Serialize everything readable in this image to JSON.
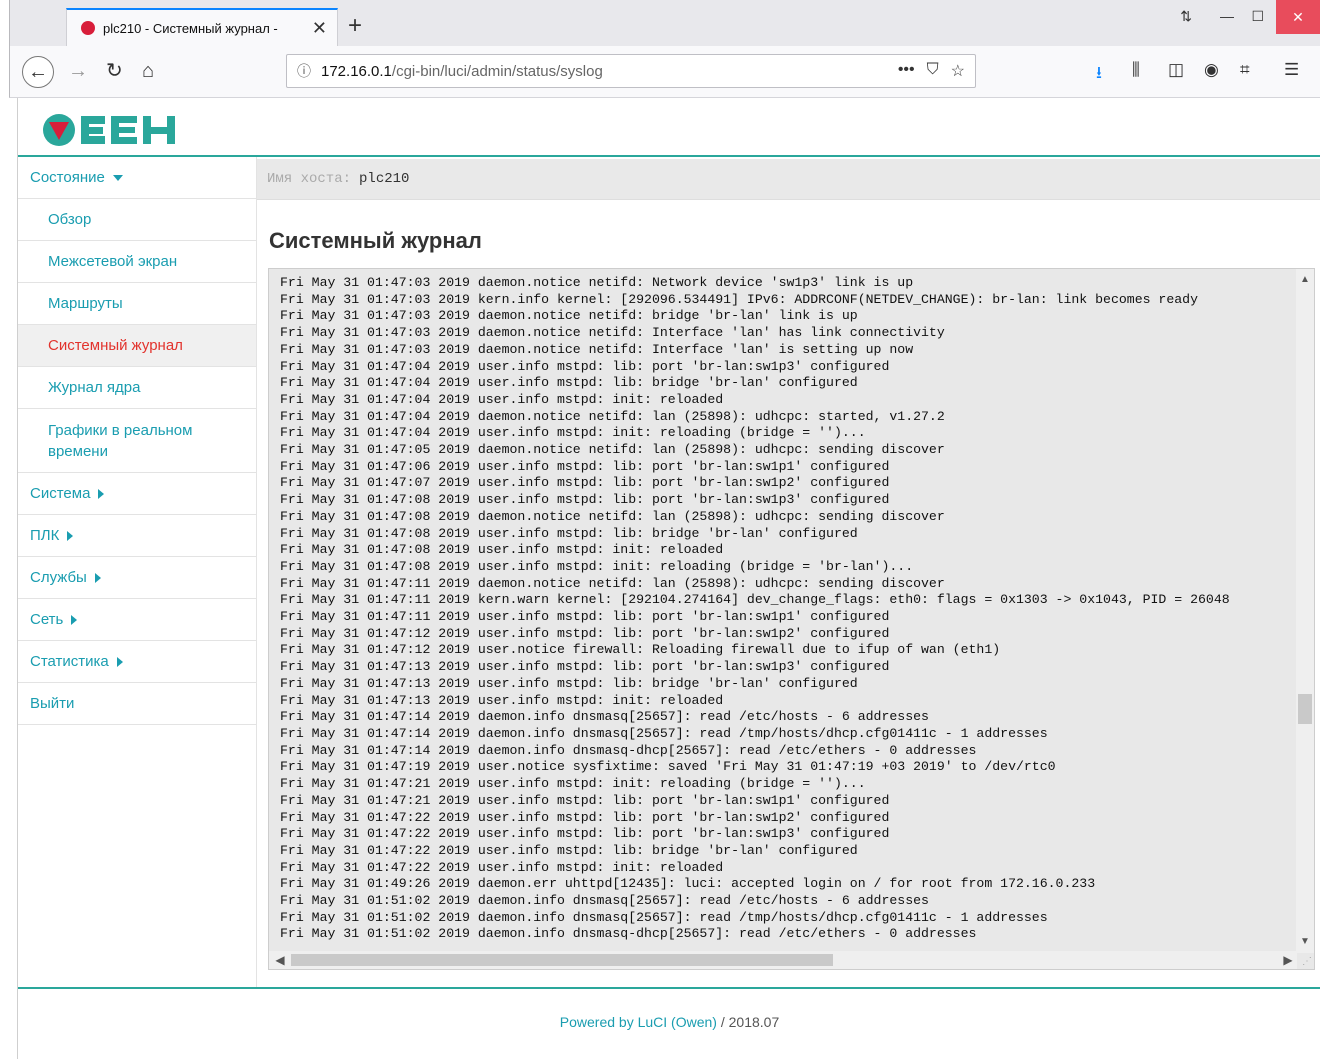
{
  "browser": {
    "tab_title": "plc210 - Системный журнал - ",
    "tab_close": "✕",
    "new_tab": "+",
    "url_host": "172.16.0.1",
    "url_path": "/cgi-bin/luci/admin/status/syslog",
    "url_actions": [
      "•••",
      "⛉",
      "☆"
    ]
  },
  "brand": {
    "logo_text": "ОВЕН"
  },
  "sidebar": {
    "items": [
      {
        "label": "Состояние"
      },
      {
        "label": "Обзор"
      },
      {
        "label": "Межсетевой экран"
      },
      {
        "label": "Маршруты"
      },
      {
        "label": "Системный журнал"
      },
      {
        "label": "Журнал ядра"
      },
      {
        "label": "Графики в реальном времени"
      },
      {
        "label": "Система"
      },
      {
        "label": "ПЛК"
      },
      {
        "label": "Службы"
      },
      {
        "label": "Сеть"
      },
      {
        "label": "Статистика"
      },
      {
        "label": "Выйти"
      }
    ]
  },
  "hostbar": {
    "label": "Имя хоста:",
    "value": "plc210"
  },
  "main": {
    "title": "Системный журнал"
  },
  "log_lines": [
    "Fri May 31 01:47:03 2019 daemon.notice netifd: Network device 'sw1p3' link is up",
    "Fri May 31 01:47:03 2019 kern.info kernel: [292096.534491] IPv6: ADDRCONF(NETDEV_CHANGE): br-lan: link becomes ready",
    "Fri May 31 01:47:03 2019 daemon.notice netifd: bridge 'br-lan' link is up",
    "Fri May 31 01:47:03 2019 daemon.notice netifd: Interface 'lan' has link connectivity",
    "Fri May 31 01:47:03 2019 daemon.notice netifd: Interface 'lan' is setting up now",
    "Fri May 31 01:47:04 2019 user.info mstpd: lib: port 'br-lan:sw1p3' configured",
    "Fri May 31 01:47:04 2019 user.info mstpd: lib: bridge 'br-lan' configured",
    "Fri May 31 01:47:04 2019 user.info mstpd: init: reloaded",
    "Fri May 31 01:47:04 2019 daemon.notice netifd: lan (25898): udhcpc: started, v1.27.2",
    "Fri May 31 01:47:04 2019 user.info mstpd: init: reloading (bridge = '')...",
    "Fri May 31 01:47:05 2019 daemon.notice netifd: lan (25898): udhcpc: sending discover",
    "Fri May 31 01:47:06 2019 user.info mstpd: lib: port 'br-lan:sw1p1' configured",
    "Fri May 31 01:47:07 2019 user.info mstpd: lib: port 'br-lan:sw1p2' configured",
    "Fri May 31 01:47:08 2019 user.info mstpd: lib: port 'br-lan:sw1p3' configured",
    "Fri May 31 01:47:08 2019 daemon.notice netifd: lan (25898): udhcpc: sending discover",
    "Fri May 31 01:47:08 2019 user.info mstpd: lib: bridge 'br-lan' configured",
    "Fri May 31 01:47:08 2019 user.info mstpd: init: reloaded",
    "Fri May 31 01:47:08 2019 user.info mstpd: init: reloading (bridge = 'br-lan')...",
    "Fri May 31 01:47:11 2019 daemon.notice netifd: lan (25898): udhcpc: sending discover",
    "Fri May 31 01:47:11 2019 kern.warn kernel: [292104.274164] dev_change_flags: eth0: flags = 0x1303 -> 0x1043, PID = 26048",
    "Fri May 31 01:47:11 2019 user.info mstpd: lib: port 'br-lan:sw1p1' configured",
    "Fri May 31 01:47:12 2019 user.info mstpd: lib: port 'br-lan:sw1p2' configured",
    "Fri May 31 01:47:12 2019 user.notice firewall: Reloading firewall due to ifup of wan (eth1)",
    "Fri May 31 01:47:13 2019 user.info mstpd: lib: port 'br-lan:sw1p3' configured",
    "Fri May 31 01:47:13 2019 user.info mstpd: lib: bridge 'br-lan' configured",
    "Fri May 31 01:47:13 2019 user.info mstpd: init: reloaded",
    "Fri May 31 01:47:14 2019 daemon.info dnsmasq[25657]: read /etc/hosts - 6 addresses",
    "Fri May 31 01:47:14 2019 daemon.info dnsmasq[25657]: read /tmp/hosts/dhcp.cfg01411c - 1 addresses",
    "Fri May 31 01:47:14 2019 daemon.info dnsmasq-dhcp[25657]: read /etc/ethers - 0 addresses",
    "Fri May 31 01:47:19 2019 user.notice sysfixtime: saved 'Fri May 31 01:47:19 +03 2019' to /dev/rtc0",
    "Fri May 31 01:47:21 2019 user.info mstpd: init: reloading (bridge = '')...",
    "Fri May 31 01:47:21 2019 user.info mstpd: lib: port 'br-lan:sw1p1' configured",
    "Fri May 31 01:47:22 2019 user.info mstpd: lib: port 'br-lan:sw1p2' configured",
    "Fri May 31 01:47:22 2019 user.info mstpd: lib: port 'br-lan:sw1p3' configured",
    "Fri May 31 01:47:22 2019 user.info mstpd: lib: bridge 'br-lan' configured",
    "Fri May 31 01:47:22 2019 user.info mstpd: init: reloaded",
    "Fri May 31 01:49:26 2019 daemon.err uhttpd[12435]: luci: accepted login on / for root from 172.16.0.233",
    "Fri May 31 01:51:02 2019 daemon.info dnsmasq[25657]: read /etc/hosts - 6 addresses",
    "Fri May 31 01:51:02 2019 daemon.info dnsmasq[25657]: read /tmp/hosts/dhcp.cfg01411c - 1 addresses",
    "Fri May 31 01:51:02 2019 daemon.info dnsmasq-dhcp[25657]: read /etc/ethers - 0 addresses"
  ],
  "footer": {
    "link_text": "Powered by LuCI (Owen)",
    "version": " / 2018.07"
  },
  "colors": {
    "accent": "#1a9db0",
    "active": "#e2332d",
    "rule": "#2aa79b"
  }
}
